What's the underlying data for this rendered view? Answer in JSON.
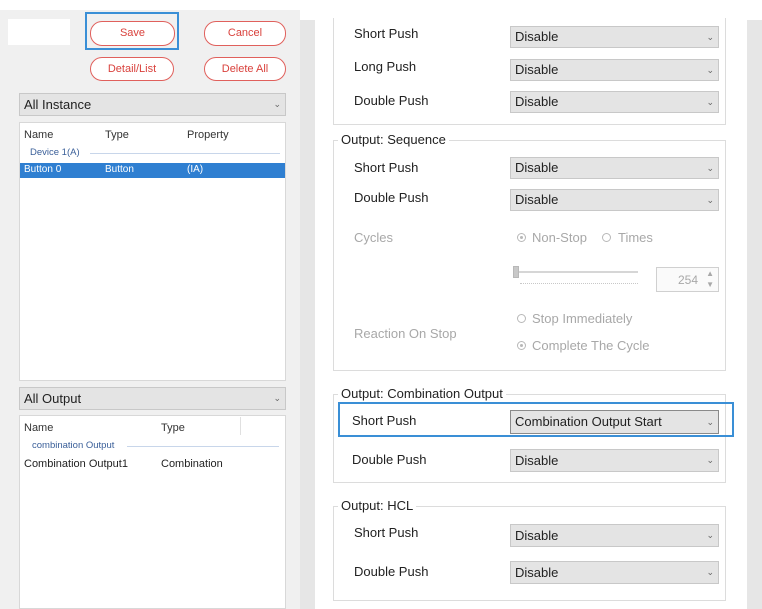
{
  "toolbar": {
    "save_label": "Save",
    "cancel_label": "Cancel",
    "detail_list_label": "Detail/List",
    "delete_all_label": "Delete All"
  },
  "instance_panel": {
    "filter_value": "All Instance",
    "columns": [
      "Name",
      "Type",
      "Property"
    ],
    "group": "Device 1(A)",
    "rows": [
      {
        "name": "Button 0",
        "type": "Button",
        "property": "(IA)"
      }
    ]
  },
  "output_panel": {
    "filter_value": "All Output",
    "columns": [
      "Name",
      "Type"
    ],
    "group": "combination Output",
    "rows": [
      {
        "name": "Combination Output1",
        "type": "Combination"
      }
    ]
  },
  "top_group": {
    "rows": [
      {
        "label": "Short Push",
        "value": "Disable"
      },
      {
        "label": "Long Push",
        "value": "Disable"
      },
      {
        "label": "Double Push",
        "value": "Disable"
      }
    ]
  },
  "sequence": {
    "title": "Output: Sequence",
    "short_push": {
      "label": "Short Push",
      "value": "Disable"
    },
    "double_push": {
      "label": "Double Push",
      "value": "Disable"
    },
    "cycles_label": "Cycles",
    "non_stop_label": "Non-Stop",
    "times_label": "Times",
    "slider_value": "254",
    "reaction_label": "Reaction On Stop",
    "stop_immediately_label": "Stop Immediately",
    "complete_cycle_label": "Complete The Cycle"
  },
  "combination": {
    "title": "Output: Combination Output",
    "short_push": {
      "label": "Short Push",
      "value": "Combination Output Start"
    },
    "double_push": {
      "label": "Double Push",
      "value": "Disable"
    }
  },
  "hcl": {
    "title": "Output: HCL",
    "short_push": {
      "label": "Short Push",
      "value": "Disable"
    },
    "double_push": {
      "label": "Double Push",
      "value": "Disable"
    }
  },
  "colors": {
    "accent": "#3a8fd6",
    "button_red": "#d9413c",
    "selection": "#2f7fd1"
  }
}
